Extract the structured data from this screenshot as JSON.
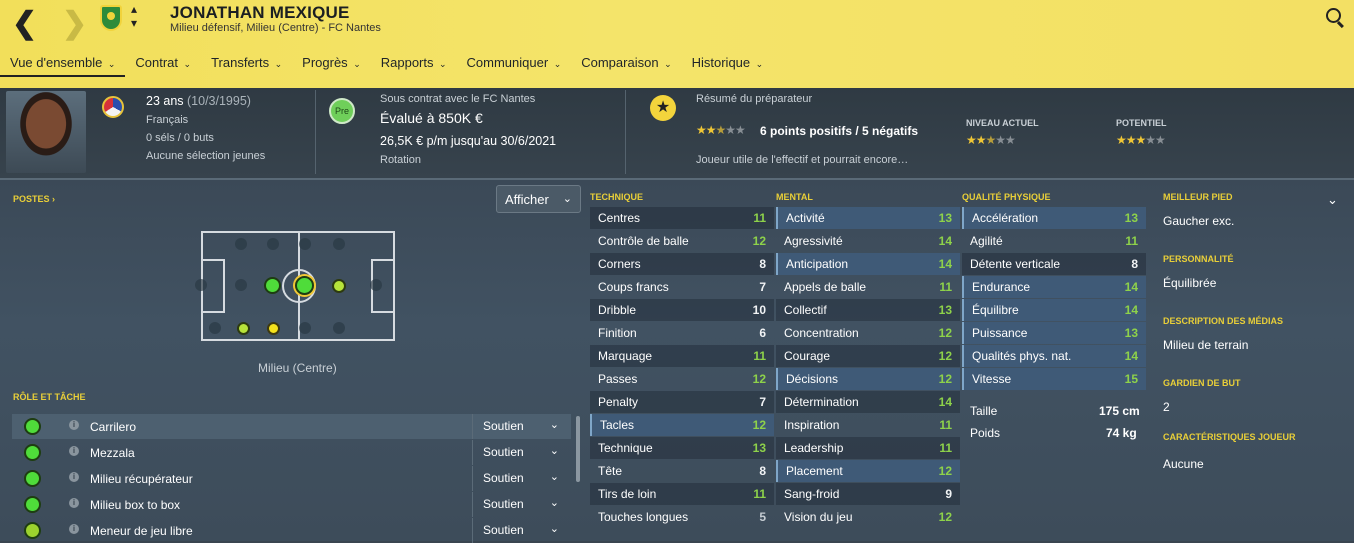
{
  "header": {
    "player_name": "JONATHAN MEXIQUE",
    "subtitle": "Milieu défensif, Milieu (Centre) - FC Nantes",
    "tabs": [
      "Vue d'ensemble",
      "Contrat",
      "Transferts",
      "Progrès",
      "Rapports",
      "Communiquer",
      "Comparaison",
      "Historique"
    ]
  },
  "summary": {
    "age": "23 ans",
    "dob": "(10/3/1995)",
    "nationality": "Français",
    "caps": "0 séls / 0 buts",
    "youth": "Aucune sélection jeunes",
    "contract_with": "Sous contrat avec le FC Nantes",
    "badge": "Pre",
    "value": "Évalué à 850K €",
    "wage": "26,5K € p/m jusqu'au 30/6/2021",
    "status": "Rotation",
    "scout_title": "Résumé du préparateur",
    "scout_points": "6 points positifs / 5 négatifs",
    "scout_stars": 2.5,
    "scout_text": "Joueur utile de l'effectif et pourrait encore…",
    "current_label": "NIVEAU ACTUEL",
    "current_stars": 2.5,
    "potential_label": "POTENTIEL",
    "potential_stars": 3
  },
  "positions": {
    "title": "POSTES",
    "show_button": "Afficher",
    "main_position": "Milieu (Centre)"
  },
  "roles": {
    "title": "RÔLE ET TÂCHE",
    "items": [
      {
        "name": "Carrilero",
        "duty": "Soutien",
        "color": "#4fdc3a"
      },
      {
        "name": "Mezzala",
        "duty": "Soutien",
        "color": "#4fdc3a"
      },
      {
        "name": "Milieu récupérateur",
        "duty": "Soutien",
        "color": "#4fdc3a"
      },
      {
        "name": "Milieu box to box",
        "duty": "Soutien",
        "color": "#4fdc3a"
      },
      {
        "name": "Meneur de jeu libre",
        "duty": "Soutien",
        "color": "#9cd22e"
      }
    ]
  },
  "technique": {
    "title": "TECHNIQUE",
    "items": [
      {
        "name": "Centres",
        "value": "11"
      },
      {
        "name": "Contrôle de balle",
        "value": "12"
      },
      {
        "name": "Corners",
        "value": "8"
      },
      {
        "name": "Coups francs",
        "value": "7"
      },
      {
        "name": "Dribble",
        "value": "10"
      },
      {
        "name": "Finition",
        "value": "6"
      },
      {
        "name": "Marquage",
        "value": "11"
      },
      {
        "name": "Passes",
        "value": "12"
      },
      {
        "name": "Penalty",
        "value": "7"
      },
      {
        "name": "Tacles",
        "value": "12"
      },
      {
        "name": "Technique",
        "value": "13"
      },
      {
        "name": "Tête",
        "value": "8"
      },
      {
        "name": "Tirs de loin",
        "value": "11"
      },
      {
        "name": "Touches longues",
        "value": "5"
      }
    ]
  },
  "mental": {
    "title": "MENTAL",
    "items": [
      {
        "name": "Activité",
        "value": "13"
      },
      {
        "name": "Agressivité",
        "value": "14"
      },
      {
        "name": "Anticipation",
        "value": "14"
      },
      {
        "name": "Appels de balle",
        "value": "11"
      },
      {
        "name": "Collectif",
        "value": "13"
      },
      {
        "name": "Concentration",
        "value": "12"
      },
      {
        "name": "Courage",
        "value": "12"
      },
      {
        "name": "Décisions",
        "value": "12"
      },
      {
        "name": "Détermination",
        "value": "14"
      },
      {
        "name": "Inspiration",
        "value": "11"
      },
      {
        "name": "Leadership",
        "value": "11"
      },
      {
        "name": "Placement",
        "value": "12"
      },
      {
        "name": "Sang-froid",
        "value": "9"
      },
      {
        "name": "Vision du jeu",
        "value": "12"
      }
    ]
  },
  "physical": {
    "title": "QUALITÉ PHYSIQUE",
    "items": [
      {
        "name": "Accélération",
        "value": "13"
      },
      {
        "name": "Agilité",
        "value": "11"
      },
      {
        "name": "Détente verticale",
        "value": "8"
      },
      {
        "name": "Endurance",
        "value": "14"
      },
      {
        "name": "Équilibre",
        "value": "14"
      },
      {
        "name": "Puissance",
        "value": "13"
      },
      {
        "name": "Qualités phys. nat.",
        "value": "14"
      },
      {
        "name": "Vitesse",
        "value": "15"
      }
    ],
    "height_label": "Taille",
    "height": "175 cm",
    "weight_label": "Poids",
    "weight": "74 kg"
  },
  "info": {
    "foot_title": "MEILLEUR PIED",
    "foot": "Gaucher exc.",
    "personality_title": "PERSONNALITÉ",
    "personality": "Équilibrée",
    "media_title": "DESCRIPTION DES MÉDIAS",
    "media": "Milieu de terrain",
    "gk_title": "GARDIEN DE BUT",
    "gk": "2",
    "traits_title": "CARACTÉRISTIQUES JOUEUR",
    "traits": "Aucune"
  },
  "colors": {
    "header_bg": "#f2df5a",
    "accent_yellow": "#e9cf38",
    "value_green": "#8ed24a",
    "highlight_blue": "#3f5a77"
  }
}
